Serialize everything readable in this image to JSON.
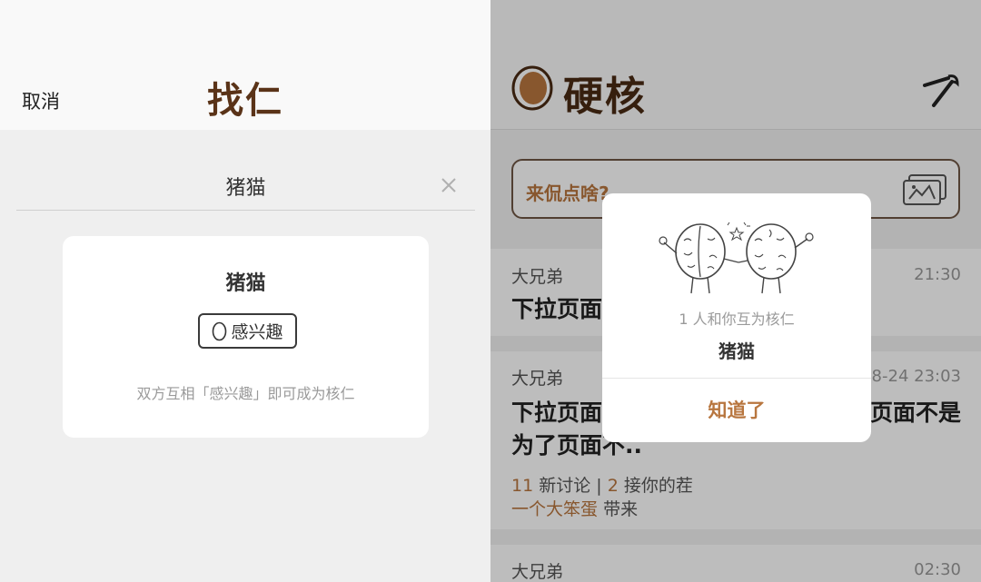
{
  "left": {
    "cancel_label": "取消",
    "title": "找仁",
    "search": {
      "value": "猪猫",
      "clear_icon": "close-icon"
    },
    "result": {
      "name": "猪猫",
      "interest_label": "感兴趣",
      "hint": "双方互相「感兴趣」即可成为核仁"
    }
  },
  "right": {
    "brand_title": "硬核",
    "brand_icon": "walnut-logo-icon",
    "action_icon": "nutcracker-icon",
    "compose": {
      "placeholder": "来侃点啥?",
      "image_icon": "image-icon"
    },
    "posts": [
      {
        "author": "大兄弟",
        "time": "21:30",
        "body_line1": "下拉页面",
        "body_line2": ""
      },
      {
        "author": "大兄弟",
        "time": "8-24  23:03",
        "body_line1": "下拉页面",
        "body_line1_tail": "页面不是",
        "body_line2": "为了页面不..",
        "stats": {
          "new_count": "11",
          "new_label": "新讨论",
          "sep": "|",
          "reply_count": "2",
          "reply_label": "接你的茬"
        },
        "from": {
          "who": "一个大笨蛋",
          "suffix": "带来"
        }
      },
      {
        "author": "大兄弟",
        "time": "02:30"
      }
    ],
    "modal": {
      "illustration": "walnut-friends-icon",
      "subtitle": "1 人和你互为核仁",
      "name": "猪猫",
      "confirm_label": "知道了"
    }
  },
  "colors": {
    "accent": "#b8763f",
    "brand_dark": "#4a2b14",
    "title_brown": "#5a3318"
  }
}
